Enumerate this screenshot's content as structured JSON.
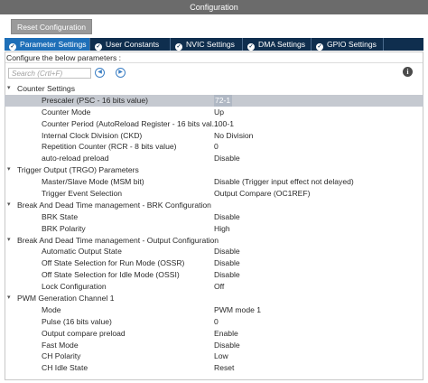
{
  "window": {
    "title": "Configuration"
  },
  "reset_label": "Reset Configuration",
  "tabs": [
    {
      "label": "Parameter Settings",
      "active": true
    },
    {
      "label": "User Constants",
      "active": false
    },
    {
      "label": "NVIC Settings",
      "active": false
    },
    {
      "label": "DMA Settings",
      "active": false
    },
    {
      "label": "GPIO Settings",
      "active": false
    }
  ],
  "configure_label": "Configure the below parameters :",
  "search": {
    "placeholder": "Search (Crtl+F)"
  },
  "icons": {
    "tab_check": "check-circle-icon",
    "prev": "arrow-left-icon",
    "next": "arrow-right-icon",
    "info": "info-icon",
    "caret": "chevron-down-icon"
  },
  "colors": {
    "tab_bar": "#0f2e4e",
    "tab_active": "#1e6fb8",
    "title_bar": "#6b6b6b",
    "selected_row": "#c5c9d0"
  },
  "groups": [
    {
      "label": "Counter Settings",
      "params": [
        {
          "name": "Prescaler (PSC - 16 bits value)",
          "value": "72-1",
          "selected": true
        },
        {
          "name": "Counter Mode",
          "value": "Up"
        },
        {
          "name": "Counter Period (AutoReload Register - 16 bits val...",
          "value": "100-1"
        },
        {
          "name": "Internal Clock Division (CKD)",
          "value": "No Division"
        },
        {
          "name": "Repetition Counter (RCR - 8 bits value)",
          "value": "0"
        },
        {
          "name": "auto-reload preload",
          "value": "Disable"
        }
      ]
    },
    {
      "label": "Trigger Output (TRGO) Parameters",
      "params": [
        {
          "name": "Master/Slave Mode (MSM bit)",
          "value": "Disable (Trigger input effect not delayed)"
        },
        {
          "name": "Trigger Event Selection",
          "value": "Output Compare (OC1REF)"
        }
      ]
    },
    {
      "label": "Break And Dead Time management - BRK Configuration",
      "params": [
        {
          "name": "BRK State",
          "value": "Disable"
        },
        {
          "name": "BRK Polarity",
          "value": "High"
        }
      ]
    },
    {
      "label": "Break And Dead Time management - Output Configuration",
      "params": [
        {
          "name": "Automatic Output State",
          "value": "Disable"
        },
        {
          "name": "Off State Selection for Run Mode (OSSR)",
          "value": "Disable"
        },
        {
          "name": "Off State Selection for Idle Mode (OSSI)",
          "value": "Disable"
        },
        {
          "name": "Lock Configuration",
          "value": "Off"
        }
      ]
    },
    {
      "label": "PWM Generation Channel 1",
      "params": [
        {
          "name": "Mode",
          "value": "PWM mode 1"
        },
        {
          "name": "Pulse (16 bits value)",
          "value": "0"
        },
        {
          "name": "Output compare preload",
          "value": "Enable"
        },
        {
          "name": "Fast Mode",
          "value": "Disable"
        },
        {
          "name": "CH Polarity",
          "value": "Low"
        },
        {
          "name": "CH Idle State",
          "value": "Reset"
        }
      ]
    }
  ]
}
